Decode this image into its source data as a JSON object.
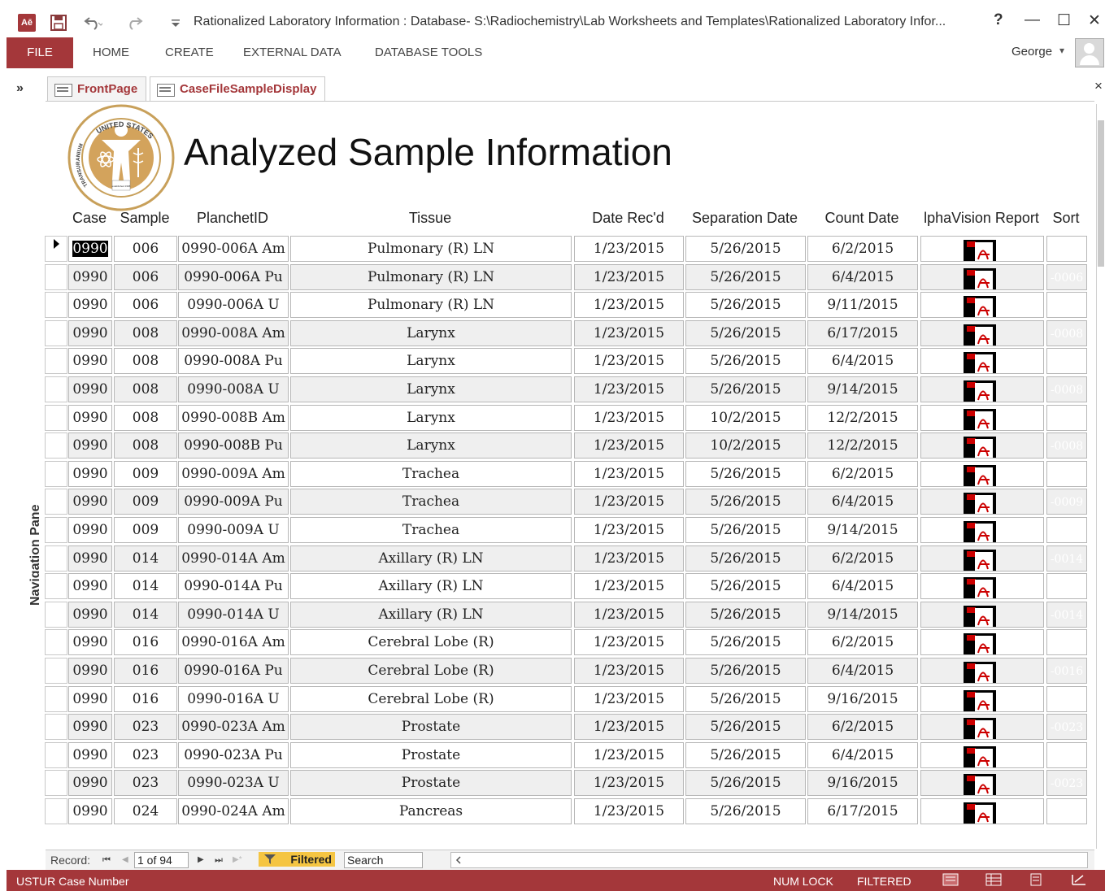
{
  "window": {
    "title": "Rationalized Laboratory Information : Database- S:\\Radiochemistry\\Lab Worksheets and Templates\\Rationalized Laboratory Infor...",
    "app_icon": "Aē",
    "help": "?",
    "minimize": "—",
    "maximize": "☐",
    "close": "✕"
  },
  "quick_access": {
    "save_icon": "save-icon",
    "undo_icon": "undo-icon",
    "redo_icon": "redo-icon",
    "customize_icon": "customize-qat-icon"
  },
  "ribbon": {
    "file": "FILE",
    "tabs": [
      "HOME",
      "CREATE",
      "EXTERNAL DATA",
      "DATABASE TOOLS"
    ],
    "user": "George",
    "user_caret": "▾"
  },
  "nav_pane": {
    "toggle": "»",
    "label": "Navigation Pane"
  },
  "doc_tabs": [
    {
      "label": "FrontPage",
      "active": false
    },
    {
      "label": "CaseFileSampleDisplay",
      "active": true
    }
  ],
  "tabs_close": "×",
  "form": {
    "title": "Analyzed Sample Information",
    "logo": {
      "top_text": "UNITED STATES",
      "left_text": "TRANSURANIUM AND URANIUM REGISTRIES",
      "center_text": "established 1968"
    },
    "columns": [
      "Case",
      "Sample",
      "PlanchetID",
      "Tissue",
      "Date Rec'd",
      "Separation Date",
      "Count Date",
      "lphaVision Report",
      "Sort"
    ],
    "rows": [
      {
        "case": "0990",
        "sample": "006",
        "planchet": "0990-006A Am",
        "tissue": "Pulmonary (R) LN",
        "date_recd": "1/23/2015",
        "separation": "5/26/2015",
        "count": "6/2/2015",
        "sort": ""
      },
      {
        "case": "0990",
        "sample": "006",
        "planchet": "0990-006A Pu",
        "tissue": "Pulmonary (R) LN",
        "date_recd": "1/23/2015",
        "separation": "5/26/2015",
        "count": "6/4/2015",
        "sort": "-0006"
      },
      {
        "case": "0990",
        "sample": "006",
        "planchet": "0990-006A U",
        "tissue": "Pulmonary (R) LN",
        "date_recd": "1/23/2015",
        "separation": "5/26/2015",
        "count": "9/11/2015",
        "sort": ""
      },
      {
        "case": "0990",
        "sample": "008",
        "planchet": "0990-008A Am",
        "tissue": "Larynx",
        "date_recd": "1/23/2015",
        "separation": "5/26/2015",
        "count": "6/17/2015",
        "sort": "-0008"
      },
      {
        "case": "0990",
        "sample": "008",
        "planchet": "0990-008A Pu",
        "tissue": "Larynx",
        "date_recd": "1/23/2015",
        "separation": "5/26/2015",
        "count": "6/4/2015",
        "sort": ""
      },
      {
        "case": "0990",
        "sample": "008",
        "planchet": "0990-008A U",
        "tissue": "Larynx",
        "date_recd": "1/23/2015",
        "separation": "5/26/2015",
        "count": "9/14/2015",
        "sort": "-0008"
      },
      {
        "case": "0990",
        "sample": "008",
        "planchet": "0990-008B Am",
        "tissue": "Larynx",
        "date_recd": "1/23/2015",
        "separation": "10/2/2015",
        "count": "12/2/2015",
        "sort": ""
      },
      {
        "case": "0990",
        "sample": "008",
        "planchet": "0990-008B Pu",
        "tissue": "Larynx",
        "date_recd": "1/23/2015",
        "separation": "10/2/2015",
        "count": "12/2/2015",
        "sort": "-0008"
      },
      {
        "case": "0990",
        "sample": "009",
        "planchet": "0990-009A Am",
        "tissue": "Trachea",
        "date_recd": "1/23/2015",
        "separation": "5/26/2015",
        "count": "6/2/2015",
        "sort": ""
      },
      {
        "case": "0990",
        "sample": "009",
        "planchet": "0990-009A Pu",
        "tissue": "Trachea",
        "date_recd": "1/23/2015",
        "separation": "5/26/2015",
        "count": "6/4/2015",
        "sort": "-0009"
      },
      {
        "case": "0990",
        "sample": "009",
        "planchet": "0990-009A U",
        "tissue": "Trachea",
        "date_recd": "1/23/2015",
        "separation": "5/26/2015",
        "count": "9/14/2015",
        "sort": ""
      },
      {
        "case": "0990",
        "sample": "014",
        "planchet": "0990-014A Am",
        "tissue": "Axillary (R) LN",
        "date_recd": "1/23/2015",
        "separation": "5/26/2015",
        "count": "6/2/2015",
        "sort": "-0014"
      },
      {
        "case": "0990",
        "sample": "014",
        "planchet": "0990-014A Pu",
        "tissue": "Axillary (R) LN",
        "date_recd": "1/23/2015",
        "separation": "5/26/2015",
        "count": "6/4/2015",
        "sort": ""
      },
      {
        "case": "0990",
        "sample": "014",
        "planchet": "0990-014A U",
        "tissue": "Axillary (R) LN",
        "date_recd": "1/23/2015",
        "separation": "5/26/2015",
        "count": "9/14/2015",
        "sort": "-0014"
      },
      {
        "case": "0990",
        "sample": "016",
        "planchet": "0990-016A Am",
        "tissue": "Cerebral Lobe (R)",
        "date_recd": "1/23/2015",
        "separation": "5/26/2015",
        "count": "6/2/2015",
        "sort": ""
      },
      {
        "case": "0990",
        "sample": "016",
        "planchet": "0990-016A Pu",
        "tissue": "Cerebral Lobe (R)",
        "date_recd": "1/23/2015",
        "separation": "5/26/2015",
        "count": "6/4/2015",
        "sort": "-0016"
      },
      {
        "case": "0990",
        "sample": "016",
        "planchet": "0990-016A U",
        "tissue": "Cerebral Lobe (R)",
        "date_recd": "1/23/2015",
        "separation": "5/26/2015",
        "count": "9/16/2015",
        "sort": ""
      },
      {
        "case": "0990",
        "sample": "023",
        "planchet": "0990-023A Am",
        "tissue": "Prostate",
        "date_recd": "1/23/2015",
        "separation": "5/26/2015",
        "count": "6/2/2015",
        "sort": "-0023"
      },
      {
        "case": "0990",
        "sample": "023",
        "planchet": "0990-023A Pu",
        "tissue": "Prostate",
        "date_recd": "1/23/2015",
        "separation": "5/26/2015",
        "count": "6/4/2015",
        "sort": ""
      },
      {
        "case": "0990",
        "sample": "023",
        "planchet": "0990-023A U",
        "tissue": "Prostate",
        "date_recd": "1/23/2015",
        "separation": "5/26/2015",
        "count": "9/16/2015",
        "sort": "-0023"
      },
      {
        "case": "0990",
        "sample": "024",
        "planchet": "0990-024A Am",
        "tissue": "Pancreas",
        "date_recd": "1/23/2015",
        "separation": "5/26/2015",
        "count": "6/17/2015",
        "sort": ""
      }
    ],
    "report_icon": "pdf-icon"
  },
  "record_bar": {
    "label": "Record:",
    "first": "⏮",
    "prev": "◀",
    "position": "1 of 94",
    "next": "▶",
    "last": "⏭",
    "new": "▶*",
    "filtered": "Filtered",
    "search": "Search"
  },
  "status_bar": {
    "left": "USTUR Case Number",
    "num_lock": "NUM LOCK",
    "filtered": "FILTERED"
  },
  "colors": {
    "accent": "#a4373a",
    "filter": "#f5c542"
  }
}
